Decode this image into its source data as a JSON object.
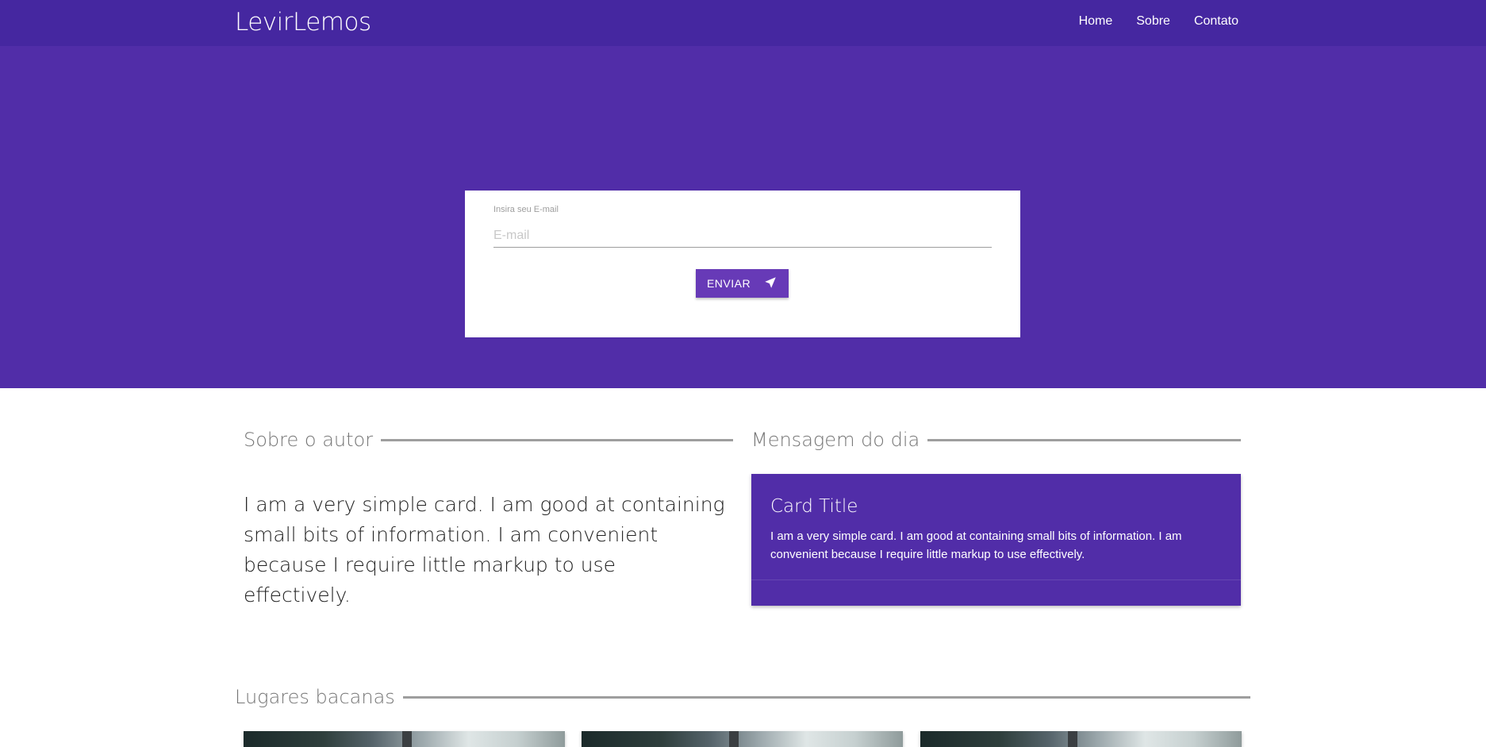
{
  "navbar": {
    "brand": "LevirLemos",
    "links": [
      "Home",
      "Sobre",
      "Contato"
    ]
  },
  "hero": {
    "form": {
      "label": "Insira seu E-mail",
      "placeholder": "E-mail",
      "value": "",
      "button_label": "ENVIAR",
      "button_icon": "send-icon"
    }
  },
  "about": {
    "title": "Sobre o autor",
    "text": "I am a very simple card. I am good at containing small bits of information. I am convenient because I require little markup to use effectively."
  },
  "message": {
    "title": "Mensagem do dia",
    "card_title": "Card Title",
    "card_text": "I am a very simple card. I am good at containing small bits of information. I am convenient because I require little markup to use effectively."
  },
  "places": {
    "title": "Lugares bacanas"
  },
  "colors": {
    "navbar": "#4527a0",
    "hero": "#512da8",
    "button": "#673ab7"
  }
}
